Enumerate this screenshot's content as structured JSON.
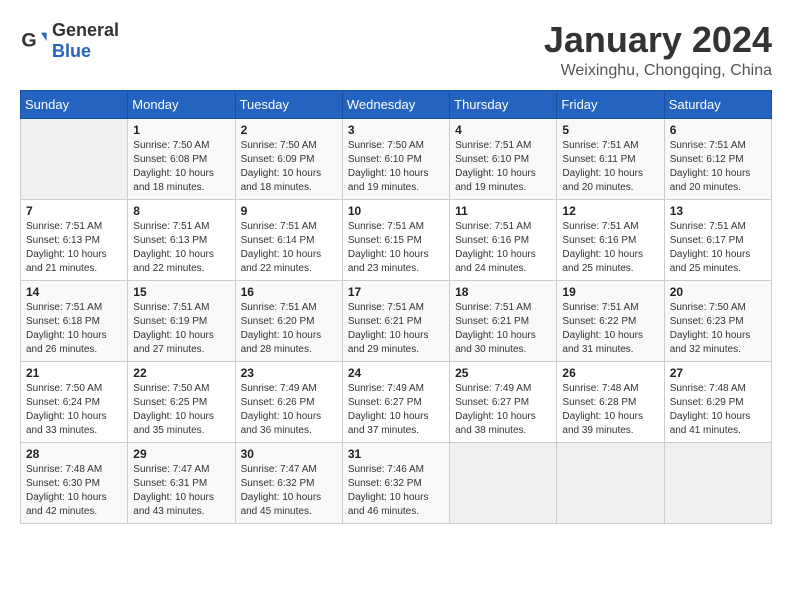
{
  "header": {
    "logo_general": "General",
    "logo_blue": "Blue",
    "month": "January 2024",
    "location": "Weixinghu, Chongqing, China"
  },
  "weekdays": [
    "Sunday",
    "Monday",
    "Tuesday",
    "Wednesday",
    "Thursday",
    "Friday",
    "Saturday"
  ],
  "weeks": [
    [
      {
        "day": "",
        "info": ""
      },
      {
        "day": "1",
        "info": "Sunrise: 7:50 AM\nSunset: 6:08 PM\nDaylight: 10 hours\nand 18 minutes."
      },
      {
        "day": "2",
        "info": "Sunrise: 7:50 AM\nSunset: 6:09 PM\nDaylight: 10 hours\nand 18 minutes."
      },
      {
        "day": "3",
        "info": "Sunrise: 7:50 AM\nSunset: 6:10 PM\nDaylight: 10 hours\nand 19 minutes."
      },
      {
        "day": "4",
        "info": "Sunrise: 7:51 AM\nSunset: 6:10 PM\nDaylight: 10 hours\nand 19 minutes."
      },
      {
        "day": "5",
        "info": "Sunrise: 7:51 AM\nSunset: 6:11 PM\nDaylight: 10 hours\nand 20 minutes."
      },
      {
        "day": "6",
        "info": "Sunrise: 7:51 AM\nSunset: 6:12 PM\nDaylight: 10 hours\nand 20 minutes."
      }
    ],
    [
      {
        "day": "7",
        "info": "Sunrise: 7:51 AM\nSunset: 6:13 PM\nDaylight: 10 hours\nand 21 minutes."
      },
      {
        "day": "8",
        "info": "Sunrise: 7:51 AM\nSunset: 6:13 PM\nDaylight: 10 hours\nand 22 minutes."
      },
      {
        "day": "9",
        "info": "Sunrise: 7:51 AM\nSunset: 6:14 PM\nDaylight: 10 hours\nand 22 minutes."
      },
      {
        "day": "10",
        "info": "Sunrise: 7:51 AM\nSunset: 6:15 PM\nDaylight: 10 hours\nand 23 minutes."
      },
      {
        "day": "11",
        "info": "Sunrise: 7:51 AM\nSunset: 6:16 PM\nDaylight: 10 hours\nand 24 minutes."
      },
      {
        "day": "12",
        "info": "Sunrise: 7:51 AM\nSunset: 6:16 PM\nDaylight: 10 hours\nand 25 minutes."
      },
      {
        "day": "13",
        "info": "Sunrise: 7:51 AM\nSunset: 6:17 PM\nDaylight: 10 hours\nand 25 minutes."
      }
    ],
    [
      {
        "day": "14",
        "info": "Sunrise: 7:51 AM\nSunset: 6:18 PM\nDaylight: 10 hours\nand 26 minutes."
      },
      {
        "day": "15",
        "info": "Sunrise: 7:51 AM\nSunset: 6:19 PM\nDaylight: 10 hours\nand 27 minutes."
      },
      {
        "day": "16",
        "info": "Sunrise: 7:51 AM\nSunset: 6:20 PM\nDaylight: 10 hours\nand 28 minutes."
      },
      {
        "day": "17",
        "info": "Sunrise: 7:51 AM\nSunset: 6:21 PM\nDaylight: 10 hours\nand 29 minutes."
      },
      {
        "day": "18",
        "info": "Sunrise: 7:51 AM\nSunset: 6:21 PM\nDaylight: 10 hours\nand 30 minutes."
      },
      {
        "day": "19",
        "info": "Sunrise: 7:51 AM\nSunset: 6:22 PM\nDaylight: 10 hours\nand 31 minutes."
      },
      {
        "day": "20",
        "info": "Sunrise: 7:50 AM\nSunset: 6:23 PM\nDaylight: 10 hours\nand 32 minutes."
      }
    ],
    [
      {
        "day": "21",
        "info": "Sunrise: 7:50 AM\nSunset: 6:24 PM\nDaylight: 10 hours\nand 33 minutes."
      },
      {
        "day": "22",
        "info": "Sunrise: 7:50 AM\nSunset: 6:25 PM\nDaylight: 10 hours\nand 35 minutes."
      },
      {
        "day": "23",
        "info": "Sunrise: 7:49 AM\nSunset: 6:26 PM\nDaylight: 10 hours\nand 36 minutes."
      },
      {
        "day": "24",
        "info": "Sunrise: 7:49 AM\nSunset: 6:27 PM\nDaylight: 10 hours\nand 37 minutes."
      },
      {
        "day": "25",
        "info": "Sunrise: 7:49 AM\nSunset: 6:27 PM\nDaylight: 10 hours\nand 38 minutes."
      },
      {
        "day": "26",
        "info": "Sunrise: 7:48 AM\nSunset: 6:28 PM\nDaylight: 10 hours\nand 39 minutes."
      },
      {
        "day": "27",
        "info": "Sunrise: 7:48 AM\nSunset: 6:29 PM\nDaylight: 10 hours\nand 41 minutes."
      }
    ],
    [
      {
        "day": "28",
        "info": "Sunrise: 7:48 AM\nSunset: 6:30 PM\nDaylight: 10 hours\nand 42 minutes."
      },
      {
        "day": "29",
        "info": "Sunrise: 7:47 AM\nSunset: 6:31 PM\nDaylight: 10 hours\nand 43 minutes."
      },
      {
        "day": "30",
        "info": "Sunrise: 7:47 AM\nSunset: 6:32 PM\nDaylight: 10 hours\nand 45 minutes."
      },
      {
        "day": "31",
        "info": "Sunrise: 7:46 AM\nSunset: 6:32 PM\nDaylight: 10 hours\nand 46 minutes."
      },
      {
        "day": "",
        "info": ""
      },
      {
        "day": "",
        "info": ""
      },
      {
        "day": "",
        "info": ""
      }
    ]
  ]
}
